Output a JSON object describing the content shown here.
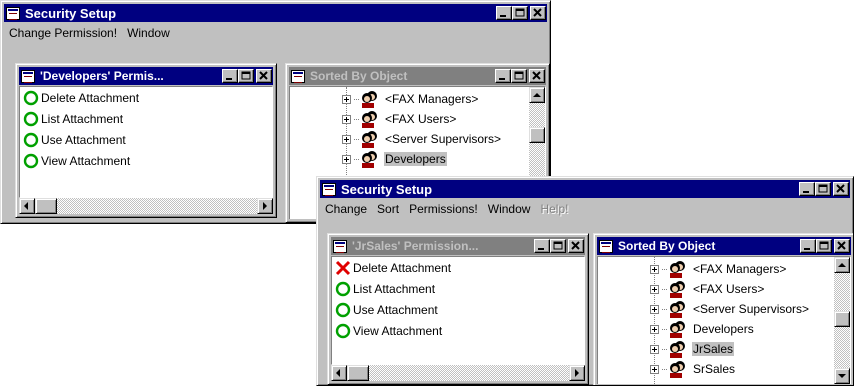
{
  "back_window": {
    "title": "Security Setup",
    "menu": [
      "Change Permission!",
      "Window"
    ],
    "permissions_pane": {
      "title": "'Developers' Permis...",
      "items": [
        {
          "label": "Delete Attachment",
          "status": "granted"
        },
        {
          "label": "List Attachment",
          "status": "granted"
        },
        {
          "label": "Use Attachment",
          "status": "granted"
        },
        {
          "label": "View Attachment",
          "status": "granted"
        }
      ]
    },
    "tree_pane": {
      "title": "Sorted By Object",
      "nodes": [
        {
          "label": "<FAX Managers>",
          "selected": false
        },
        {
          "label": "<FAX Users>",
          "selected": false
        },
        {
          "label": "<Server Supervisors>",
          "selected": false
        },
        {
          "label": "Developers",
          "selected": true
        }
      ]
    }
  },
  "front_window": {
    "title": "Security Setup",
    "menu": [
      {
        "label": "Change",
        "disabled": false
      },
      {
        "label": "Sort",
        "disabled": false
      },
      {
        "label": "Permissions!",
        "disabled": false
      },
      {
        "label": "Window",
        "disabled": false
      },
      {
        "label": "Help!",
        "disabled": true
      }
    ],
    "permissions_pane": {
      "title": "'JrSales' Permission...",
      "items": [
        {
          "label": "Delete Attachment",
          "status": "denied"
        },
        {
          "label": "List Attachment",
          "status": "granted"
        },
        {
          "label": "Use Attachment",
          "status": "granted"
        },
        {
          "label": "View Attachment",
          "status": "granted"
        }
      ]
    },
    "tree_pane": {
      "title": "Sorted By Object",
      "nodes": [
        {
          "label": "<FAX Managers>",
          "selected": false
        },
        {
          "label": "<FAX Users>",
          "selected": false
        },
        {
          "label": "<Server Supervisors>",
          "selected": false
        },
        {
          "label": "Developers",
          "selected": false
        },
        {
          "label": "JrSales",
          "selected": true
        },
        {
          "label": "SrSales",
          "selected": false
        }
      ]
    }
  },
  "colors": {
    "active_title": "#000080",
    "inactive_title": "#808080",
    "granted_icon": "#00a000",
    "denied_icon": "#e00000",
    "face": "#c0c0c0"
  },
  "icons": {
    "granted": "green-circle-icon",
    "denied": "red-x-icon",
    "user": "user-group-icon",
    "app": "security-app-icon"
  }
}
